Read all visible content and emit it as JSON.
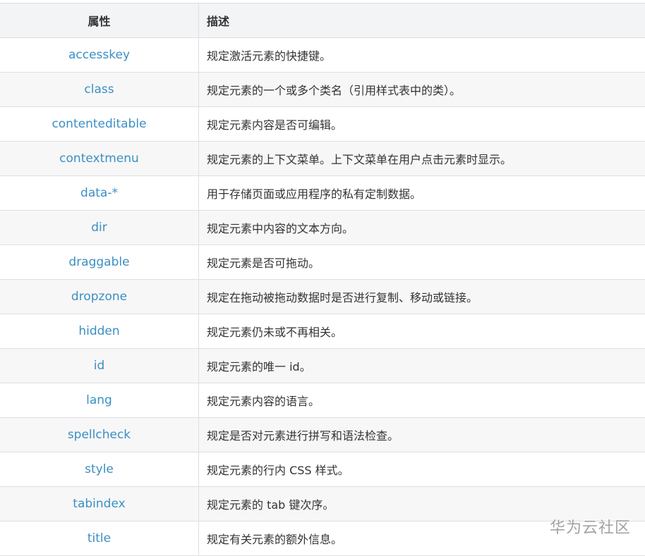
{
  "table": {
    "headers": {
      "attr": "属性",
      "desc": "描述"
    },
    "rows": [
      {
        "attr": "accesskey",
        "desc": "规定激活元素的快捷键。"
      },
      {
        "attr": "class",
        "desc": "规定元素的一个或多个类名（引用样式表中的类）。"
      },
      {
        "attr": "contenteditable",
        "desc": "规定元素内容是否可编辑。"
      },
      {
        "attr": "contextmenu",
        "desc": "规定元素的上下文菜单。上下文菜单在用户点击元素时显示。"
      },
      {
        "attr": "data-*",
        "desc": "用于存储页面或应用程序的私有定制数据。"
      },
      {
        "attr": "dir",
        "desc": "规定元素中内容的文本方向。"
      },
      {
        "attr": "draggable",
        "desc": "规定元素是否可拖动。"
      },
      {
        "attr": "dropzone",
        "desc": "规定在拖动被拖动数据时是否进行复制、移动或链接。"
      },
      {
        "attr": "hidden",
        "desc": "规定元素仍未或不再相关。"
      },
      {
        "attr": "id",
        "desc": "规定元素的唯一 id。"
      },
      {
        "attr": "lang",
        "desc": "规定元素内容的语言。"
      },
      {
        "attr": "spellcheck",
        "desc": "规定是否对元素进行拼写和语法检查。"
      },
      {
        "attr": "style",
        "desc": "规定元素的行内 CSS 样式。"
      },
      {
        "attr": "tabindex",
        "desc": "规定元素的 tab 键次序。"
      },
      {
        "attr": "title",
        "desc": "规定有关元素的额外信息。"
      }
    ]
  },
  "watermark": "华为云社区"
}
